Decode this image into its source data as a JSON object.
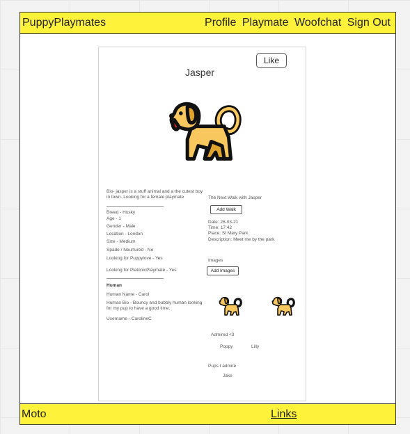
{
  "header": {
    "brand": "PuppyPlaymates",
    "nav": [
      "Profile",
      "Playmate",
      "Woofchat",
      "Sign Out"
    ]
  },
  "footer": {
    "left": "Moto",
    "links": "Links"
  },
  "profile": {
    "like_label": "Like",
    "name": "Jasper",
    "bio": "Bio-  jasper is a stuff animal and a the cutest boy in town.  Looking for a female playmate",
    "details": [
      "Breed -  Husky",
      "Age -  1",
      "Gender - Male",
      "Location - London",
      "Size - Medium",
      "Spade / Neurtured - No"
    ],
    "puppylove": "Looking for Puppylove -  Yes",
    "platonic": "Looking for PlatonicPlaymate - Yes"
  },
  "human": {
    "heading": "Human",
    "name": "Human Name - Carol",
    "bio": "Human Bio  -  Bouncy and bubbly human looking for my pup to have a good time.",
    "username": "Username -  CarolineC"
  },
  "walk": {
    "title": "The Next Walk with Jasper",
    "add_label": "Add Walk",
    "date": "Date: 26-03-21",
    "time": "Time: 17:42",
    "place": "Place: St Mary Park",
    "description": "Description: Meet me by the park"
  },
  "images": {
    "title": "Images",
    "add_label": "Add Images"
  },
  "admired": {
    "title": "Admired <3",
    "names": [
      "Poppy",
      "Lilly"
    ]
  },
  "pups_i_admire": {
    "title": "Pups I admire",
    "names": [
      "Jake"
    ]
  },
  "colors": {
    "bar": "#fff23b",
    "dog_body": "#f8c75e",
    "dog_dark": "#e0a42c",
    "outline": "#111111",
    "tongue": "#d8282a"
  },
  "icons": [
    "dog-icon"
  ]
}
